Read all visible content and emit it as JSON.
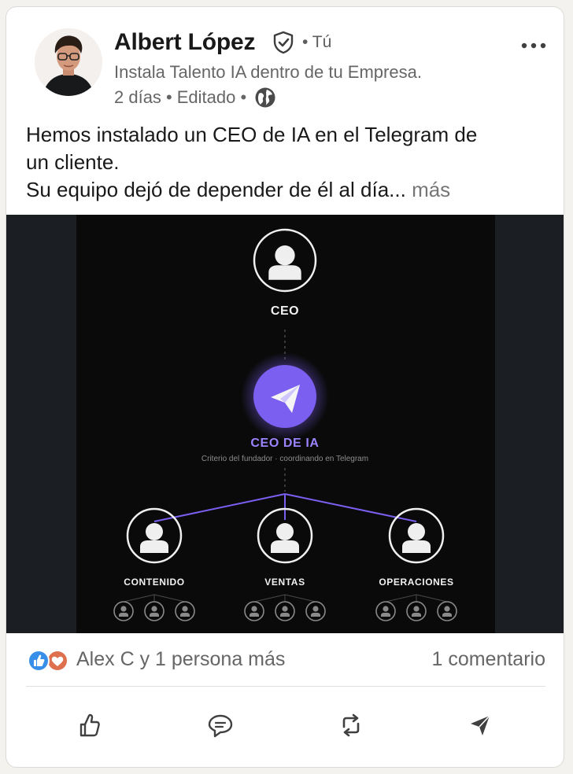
{
  "post": {
    "author_name": "Albert López",
    "degree": "• Tú",
    "headline": "Instala Talento IA dentro de tu Empresa.",
    "time": "2 días",
    "edited": "• Editado •",
    "text_line1": "Hemos instalado un CEO de IA en el Telegram de",
    "text_line2": "un cliente.",
    "text_line3": "Su equipo dejó de depender de él al día...",
    "see_more": "más"
  },
  "diagram": {
    "top_label": "CEO",
    "ai_label": "CEO DE IA",
    "ai_subtitle": "Criterio del fundador · coordinando en Telegram",
    "teams": [
      "CONTENIDO",
      "VENTAS",
      "OPERACIONES"
    ]
  },
  "social": {
    "reactions_text": "Alex C y 1 persona más",
    "comments_text": "1 comentario"
  },
  "icons": {
    "verified": "shield-check-icon",
    "visibility": "globe-icon",
    "more": "more-horizontal-icon",
    "like": "thumbs-up-icon",
    "comment": "comment-icon",
    "repost": "repost-icon",
    "send": "send-icon"
  },
  "colors": {
    "accent_purple": "#7b5ff0",
    "like_blue": "#378fe9",
    "love_red": "#df704d"
  }
}
